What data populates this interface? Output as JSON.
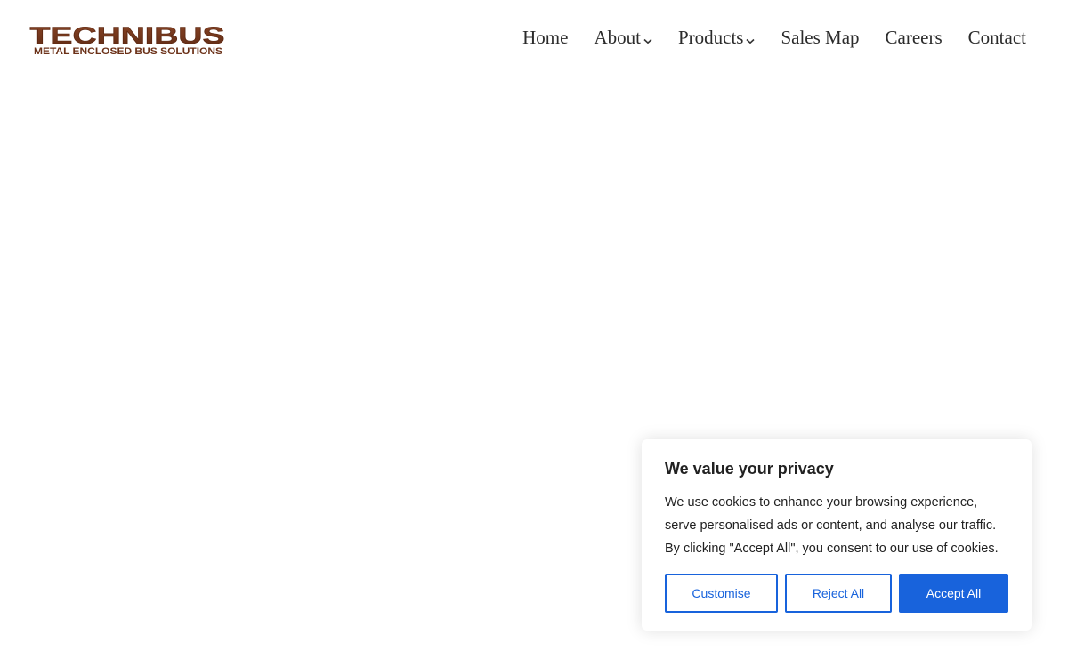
{
  "logo": {
    "wordmark": "TECHNIBUS",
    "tagline": "METAL ENCLOSED BUS SOLUTIONS",
    "color": "#7a3a1e"
  },
  "nav": {
    "items": [
      {
        "label": "Home",
        "has_dropdown": false
      },
      {
        "label": "About",
        "has_dropdown": true
      },
      {
        "label": "Products",
        "has_dropdown": true
      },
      {
        "label": "Sales Map",
        "has_dropdown": false
      },
      {
        "label": "Careers",
        "has_dropdown": false
      },
      {
        "label": "Contact",
        "has_dropdown": false
      }
    ],
    "dropdown_icon": "chevron-down-icon"
  },
  "cookie_banner": {
    "title": "We value your privacy",
    "text": "We use cookies to enhance your browsing experience, serve personalised ads or content, and analyse our traffic. By clicking \"Accept All\", you consent to our use of cookies.",
    "customise_label": "Customise",
    "reject_label": "Reject All",
    "accept_label": "Accept All",
    "accent_color": "#1863dc"
  }
}
